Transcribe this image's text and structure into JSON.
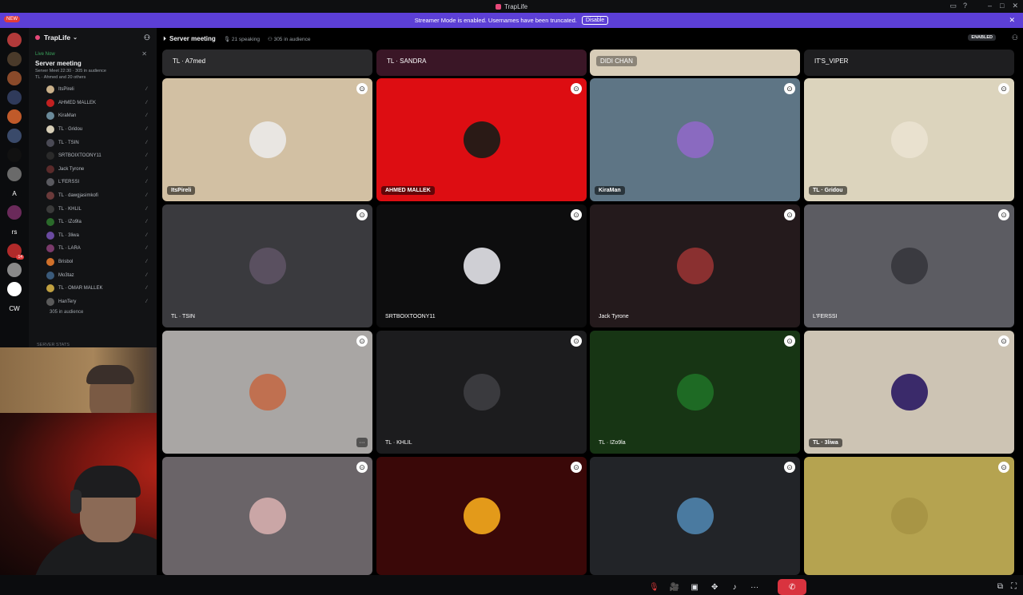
{
  "window": {
    "title": "TrapLife"
  },
  "banner": {
    "text": "Streamer Mode is enabled. Usernames have been truncated.",
    "button": "Disable",
    "close": "✕"
  },
  "new_badge": "NEW",
  "servers": [
    {
      "label": "",
      "color": "#b23a3a",
      "pill": ""
    },
    {
      "label": "",
      "color": "#4a3a2a",
      "pill": ""
    },
    {
      "label": "",
      "color": "#8a4a2a",
      "pill": ""
    },
    {
      "label": "",
      "color": "#2f3a5a",
      "pill": ""
    },
    {
      "label": "",
      "color": "#c05a2a",
      "pill": ""
    },
    {
      "label": "",
      "color": "#3a4a6a",
      "pill": ""
    },
    {
      "label": "",
      "color": "#111111",
      "pill": ""
    },
    {
      "label": "",
      "color": "#6a6a6a",
      "pill": ""
    },
    {
      "label": "A",
      "color": "#0b0c0e",
      "pill": ""
    },
    {
      "label": "",
      "color": "#6a2a5a",
      "pill": ""
    },
    {
      "label": "rs",
      "color": "#0b0c0e",
      "pill": ""
    },
    {
      "label": "",
      "color": "#b02a2a",
      "pill": "14"
    },
    {
      "label": "",
      "color": "#8a8a8a",
      "pill": ""
    },
    {
      "label": "",
      "color": "#ffffff",
      "pill": ""
    },
    {
      "label": "CW",
      "color": "#0b0c0e",
      "pill": ""
    }
  ],
  "sidebar": {
    "guild_name": "TrapLife",
    "live_now": "Live Now",
    "stage_title": "Server meeting",
    "stage_meta": "Server Meet 22:30 · 305 in audience",
    "stage_meta2": "TL · Ahmed and 20 others",
    "members": [
      {
        "name": "ItsPireli",
        "color": "#c9b08a"
      },
      {
        "name": "AHMED MALLEK",
        "color": "#c22020"
      },
      {
        "name": "KiraMan",
        "color": "#6a8a9a"
      },
      {
        "name": "TL · Gridou",
        "color": "#d8cfb8"
      },
      {
        "name": "TL · TSIN",
        "color": "#4a4a55"
      },
      {
        "name": "SRTBOIXTOONY11",
        "color": "#2a2a2a"
      },
      {
        "name": "Jack Tyrone",
        "color": "#5a2a2a"
      },
      {
        "name": "L'FERSSI",
        "color": "#5a5a60"
      },
      {
        "name": "TL · dawgjasimkofi",
        "color": "#6a3a3a"
      },
      {
        "name": "TL · KHLIL",
        "color": "#3a3a3a"
      },
      {
        "name": "TL · IZo9la",
        "color": "#2a6a2a"
      },
      {
        "name": "TL · 3liwa",
        "color": "#6a4aa0"
      },
      {
        "name": "TL · LARA",
        "color": "#7a3a6a"
      },
      {
        "name": "Brisbol",
        "color": "#d0702a"
      },
      {
        "name": "Mo3taz",
        "color": "#3a5a7a"
      },
      {
        "name": "TL · OMAR MALLEK",
        "color": "#c0a040"
      },
      {
        "name": "HanTery",
        "color": "#5a5a5a"
      }
    ],
    "audience": "305 in audience",
    "server_stats": "SERVER STATS"
  },
  "header": {
    "title": "Server meeting",
    "speaking": "21 speaking",
    "audience": "305 in audience",
    "enabled": "ENABLED"
  },
  "top_strip": [
    {
      "name": "TL · A7med",
      "bg": "#2a2a2c",
      "dark": false
    },
    {
      "name": "TL · SANDRA",
      "bg": "#3a1626",
      "dark": false
    },
    {
      "name": "DIDI CHAN",
      "bg": "#d8cdb8",
      "dark": true
    },
    {
      "name": "IT'S_VIPER",
      "bg": "#1e1e20",
      "dark": false
    }
  ],
  "tiles": [
    {
      "name": "ItsPireli",
      "bg": "#d2c0a3",
      "av": "#e9e6e2",
      "tag": true
    },
    {
      "name": "AHMED MALLEK",
      "bg": "#dd0d12",
      "av": "#2a1a16",
      "tag": true
    },
    {
      "name": "KiraMan",
      "bg": "#5e7585",
      "av": "#8a6ac0",
      "tag": true
    },
    {
      "name": "TL · Gridou",
      "bg": "#dcd4bd",
      "av": "#e9e1cf",
      "tag": true
    },
    {
      "name": "TL · TSIN",
      "bg": "#3a3a3e",
      "av": "#5a5060",
      "tag": false
    },
    {
      "name": "SRTBOIXTOONY11",
      "bg": "#0d0d0e",
      "av": "#cfcfd4",
      "tag": false
    },
    {
      "name": "Jack Tyrone",
      "bg": "#241a1c",
      "av": "#8a3030",
      "tag": false
    },
    {
      "name": "L'FERSSI",
      "bg": "#5c5c62",
      "av": "#3a3a40",
      "tag": false
    },
    {
      "name": "",
      "bg": "#a9a6a4",
      "av": "#c07050",
      "tag": false
    },
    {
      "name": "TL · KHLIL",
      "bg": "#1c1c1e",
      "av": "#3a3a3e",
      "tag": false
    },
    {
      "name": "TL · IZo9la",
      "bg": "#173514",
      "av": "#1e6a24",
      "tag": false
    },
    {
      "name": "TL · 3liwa",
      "bg": "#cdc4b4",
      "av": "#3a2a6a",
      "tag": true
    },
    {
      "name": "",
      "bg": "#6a6468",
      "av": "#caa6a6",
      "tag": false
    },
    {
      "name": "",
      "bg": "#3a0808",
      "av": "#e39a1a",
      "tag": false
    },
    {
      "name": "",
      "bg": "#222428",
      "av": "#4a7aa0",
      "tag": false
    },
    {
      "name": "",
      "bg": "#b5a350",
      "av": "#a89545",
      "tag": false
    }
  ],
  "controls": {
    "mic": "🎙",
    "camera": "🎥",
    "share": "▣",
    "activity": "✥",
    "soundboard": "♪",
    "more": "···",
    "leave": "✆"
  }
}
